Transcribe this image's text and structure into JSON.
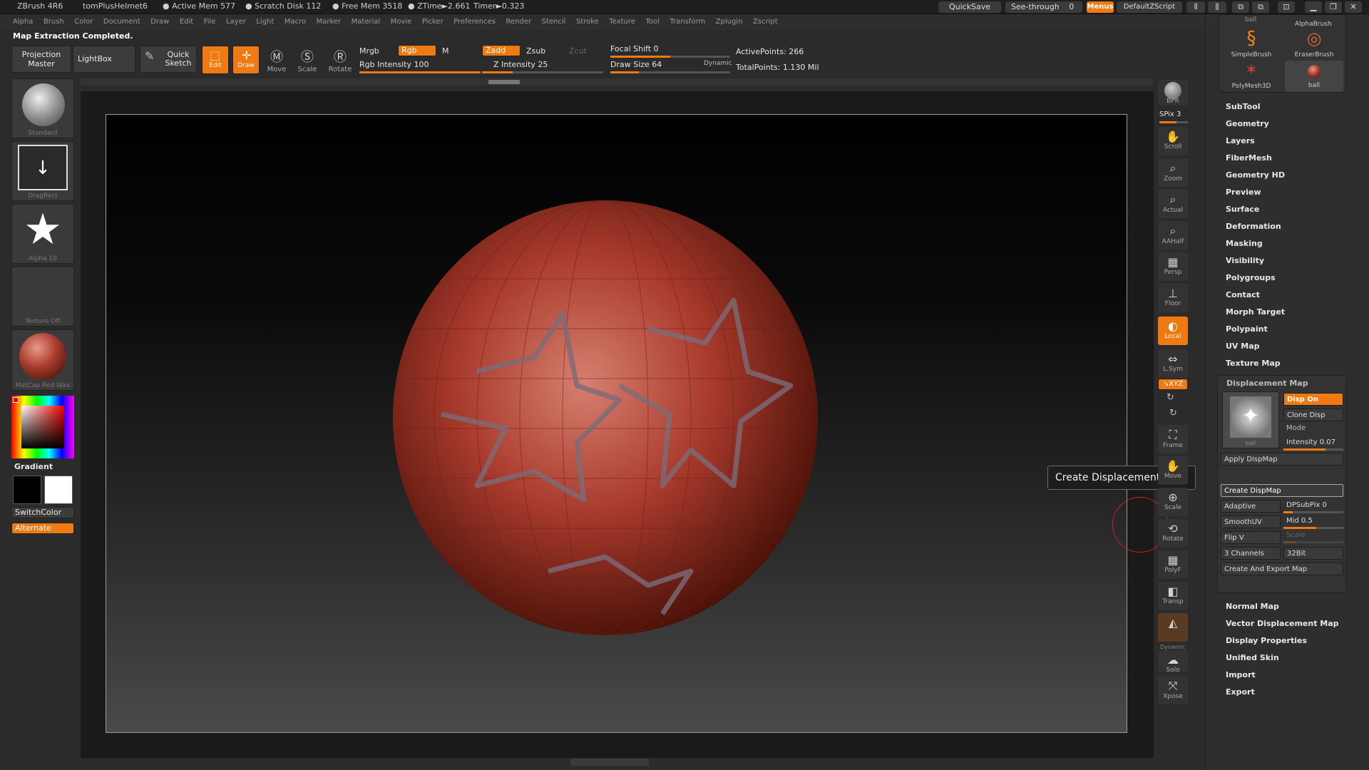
{
  "titlebar": {
    "app": "ZBrush 4R6",
    "doc": "tomPlusHelmet6",
    "active_mem": "● Active Mem 577",
    "scratch": "● Scratch Disk 112",
    "free_mem": "● Free Mem 3518",
    "ztime": "● ZTime►2.661",
    "timer": "Timer►0.323",
    "quicksave": "QuickSave",
    "see_through": "See-through",
    "see_through_value": "0",
    "menus": "Menus",
    "script": "DefaultZScript"
  },
  "menu": [
    "Alpha",
    "Brush",
    "Color",
    "Document",
    "Draw",
    "Edit",
    "File",
    "Layer",
    "Light",
    "Macro",
    "Marker",
    "Material",
    "Movie",
    "Picker",
    "Preferences",
    "Render",
    "Stencil",
    "Stroke",
    "Texture",
    "Tool",
    "Transform",
    "Zplugin",
    "Zscript"
  ],
  "status": "Map Extraction Completed.",
  "shelf": {
    "projection_master": "Projection Master",
    "lightbox": "LightBox",
    "quick_sketch": "Quick Sketch",
    "edit": "Edit",
    "draw": "Draw",
    "move": "Move",
    "scale": "Scale",
    "rotate": "Rotate",
    "mrgb": "Mrgb",
    "rgb": "Rgb",
    "m": "M",
    "rgb_intensity": "Rgb Intensity 100",
    "rgb_intensity_value": 100,
    "zadd": "Zadd",
    "zsub": "Zsub",
    "zcut": "Zcut",
    "z_intensity": "Z Intensity 25",
    "z_intensity_value": 25,
    "focal_shift": "Focal Shift 0",
    "draw_size": "Draw Size 64",
    "dynamic": "Dynamic",
    "active_points": "ActivePoints: 266",
    "total_points": "TotalPoints: 1.130 Mil"
  },
  "left": {
    "standard": "Standard",
    "dragrect": "DragRect",
    "alpha": "Alpha 10",
    "texture": "Texture Off",
    "matcap": "MatCap Red Wax",
    "gradient": "Gradient",
    "switchcolor": "SwitchColor",
    "alternate": "Alternate"
  },
  "righttools": {
    "bpr": "BPR",
    "spix": "SPix 3",
    "scroll": "Scroll",
    "zoom": "Zoom",
    "actual": "Actual",
    "aahalf": "AAHalf",
    "persp": "Persp",
    "floor": "Floor",
    "local": "Local",
    "lsym": "L.Sym",
    "xyz": "↘XYZ",
    "frame": "Frame",
    "move": "Move",
    "scale": "Scale",
    "rotate": "Rotate",
    "polyf": "PolyF",
    "transp": "Transp",
    "dynamic": "Dynamic",
    "solo": "Solo",
    "xpose": "Xpose"
  },
  "palette": {
    "brushes": [
      {
        "name": "SimpleBrush"
      },
      {
        "name": "EraserBrush"
      },
      {
        "name": "PolyMesh3D"
      },
      {
        "name": "ball"
      }
    ],
    "alphabrush": "AlphaBrush",
    "ball_top": "ball",
    "items": [
      "SubTool",
      "Geometry",
      "Layers",
      "FiberMesh",
      "Geometry HD",
      "Preview",
      "Surface",
      "Deformation",
      "Masking",
      "Visibility",
      "Polygroups",
      "Contact",
      "Morph Target",
      "Polypaint",
      "UV Map",
      "Texture Map"
    ],
    "displacement": {
      "title": "Displacement Map",
      "disp_on": "Disp On",
      "clone_disp": "Clone Disp",
      "mode": "Mode",
      "intensity": "Intensity 0.07",
      "thumb_label": "ball",
      "apply": "Apply DispMap",
      "create": "Create DispMap",
      "adaptive": "Adaptive",
      "dpsubpix": "DPSubPix 0",
      "smoothuv": "SmoothUV",
      "mid": "Mid 0.5",
      "flip_v": "Flip V",
      "scale": "Scale",
      "channels": "3 Channels",
      "bit": "32Bit",
      "create_export": "Create And Export Map"
    },
    "items_bottom": [
      "Normal Map",
      "Vector Displacement Map",
      "Display Properties",
      "Unified Skin",
      "Import",
      "Export"
    ]
  },
  "tooltip": "Create Displacement Map",
  "colors": {
    "accent": "#f07a12",
    "sphere": "#a83a2c"
  }
}
